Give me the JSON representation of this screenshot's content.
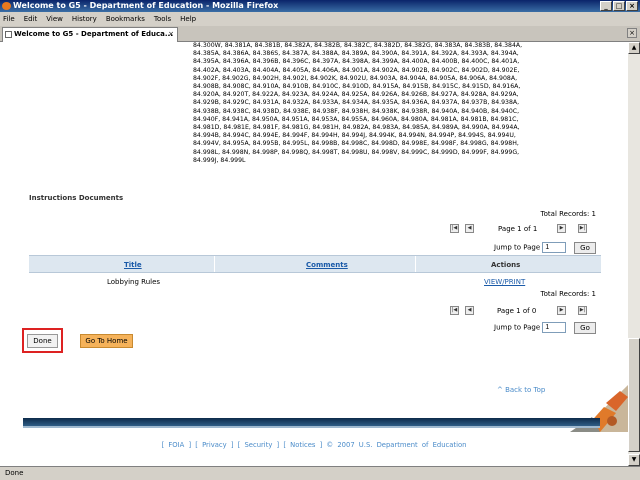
{
  "window": {
    "title": "Welcome to G5 - Department of Education - Mozilla Firefox",
    "min": "_",
    "max": "□",
    "close": "×"
  },
  "menu": [
    "File",
    "Edit",
    "View",
    "History",
    "Bookmarks",
    "Tools",
    "Help"
  ],
  "tab": {
    "label": "Welcome to G5 - Department of Educa...",
    "close": "×",
    "strip_close": "×"
  },
  "codes_lines": [
    "84.300W, 84.381A, 84.381B, 84.382A, 84.382B, 84.382C, 84.382D, 84.382G, 84.383A, 84.383B, 84.384A,",
    "84.385A, 84.386A, 84.386S, 84.387A, 84.388A, 84.389A, 84.390A, 84.391A, 84.392A, 84.393A, 84.394A,",
    "84.395A, 84.396A, 84.396B, 84.396C, 84.397A, 84.398A, 84.399A, 84.400A, 84.400B, 84.400C, 84.401A,",
    "84.402A, 84.403A, 84.404A, 84.405A, 84.406A, 84.901A, 84.902A, 84.902B, 84.902C, 84.902D, 84.902E,",
    "84.902F, 84.902G, 84.902H, 84.902I, 84.902K, 84.902U, 84.903A, 84.904A, 84.905A, 84.906A, 84.908A,",
    "84.908B, 84.908C, 84.910A, 84.910B, 84.910C, 84.910D, 84.915A, 84.915B, 84.915C, 84.915D, 84.916A,",
    "84.920A, 84.920T, 84.922A, 84.923A, 84.924A, 84.925A, 84.926A, 84.926B, 84.927A, 84.928A, 84.929A,",
    "84.929B, 84.929C, 84.931A, 84.932A, 84.933A, 84.934A, 84.935A, 84.936A, 84.937A, 84.937B, 84.938A,",
    "84.938B, 84.938C, 84.938D, 84.938E, 84.938F, 84.938H, 84.938K, 84.938R, 84.940A, 84.940B, 84.940C,",
    "84.940F, 84.941A, 84.950A, 84.951A, 84.953A, 84.955A, 84.960A, 84.980A, 84.981A, 84.981B, 84.981C,",
    "84.981D, 84.981E, 84.981F, 84.981G, 84.981H, 84.982A, 84.983A, 84.985A, 84.989A, 84.990A, 84.994A,",
    "84.994B, 84.994C, 84.994E, 84.994F, 84.994H, 84.994J, 84.994K, 84.994N, 84.994P, 84.994S, 84.994U,",
    "84.994V, 84.995A, 84.995B, 84.995L, 84.998B, 84.998C, 84.998D, 84.998E, 84.998F, 84.998G, 84.998H,",
    "84.998L, 84.998N, 84.998P, 84.998Q, 84.998T, 84.998U, 84.998V, 84.999C, 84.999D, 84.999F, 84.999G,",
    "84.999J, 84.999L"
  ],
  "instructions": {
    "title": "Instructions Documents",
    "total_top": "Total Records: 1",
    "page_top": "Page 1 of 1",
    "jump_label": "Jump to Page",
    "jump_value": "1",
    "go": "Go",
    "nav": {
      "first": "|◀",
      "prev": "◀",
      "next": "▶",
      "last": "▶|"
    },
    "columns": {
      "title": "Title",
      "comments": "Comments",
      "actions": "Actions"
    },
    "rows": [
      {
        "title": "Lobbying Rules",
        "comments": "",
        "action": "VIEW/PRINT"
      }
    ],
    "total_bottom": "Total Records: 1",
    "page_bottom": "Page 1 of 0"
  },
  "buttons": {
    "done": "Done",
    "home": "Go To Home"
  },
  "back_to_top": "^ Back to Top",
  "footer": "[ FOIA ] [ Privacy ] [ Security ] [ Notices ] © 2007 U.S. Department of Education",
  "status": "Done"
}
